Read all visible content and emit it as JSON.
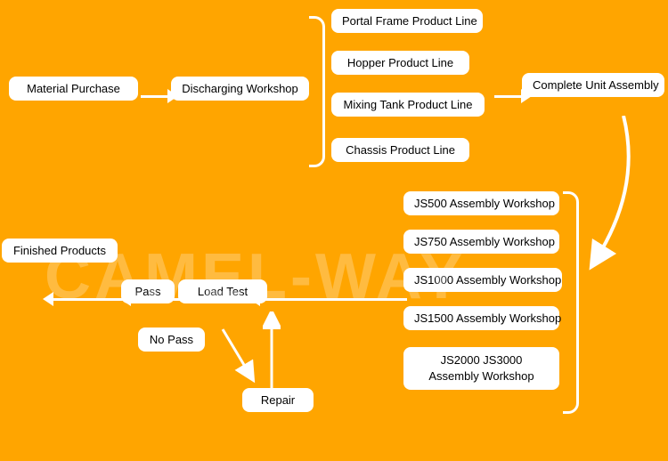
{
  "boxes": {
    "material_purchase": "Material Purchase",
    "discharging_workshop": "Discharging Workshop",
    "portal_frame": "Portal Frame Product Line",
    "hopper": "Hopper Product Line",
    "mixing_tank": "Mixing Tank Product Line",
    "chassis": "Chassis Product Line",
    "complete_unit": "Complete Unit Assembly",
    "js500": "JS500 Assembly Workshop",
    "js750": "JS750 Assembly Workshop",
    "js1000": "JS1000 Assembly Workshop",
    "js1500": "JS1500 Assembly Workshop",
    "js2000_3000": "JS2000  JS3000\nAssembly Workshop",
    "load_test": "Load Test",
    "pass": "Pass",
    "no_pass": "No Pass",
    "finished_products": "Finished Products",
    "repair": "Repair"
  },
  "watermark": "CAMEL-WAY",
  "colors": {
    "background": "#FFA500",
    "box_bg": "#ffffff",
    "arrow": "#ffffff"
  }
}
